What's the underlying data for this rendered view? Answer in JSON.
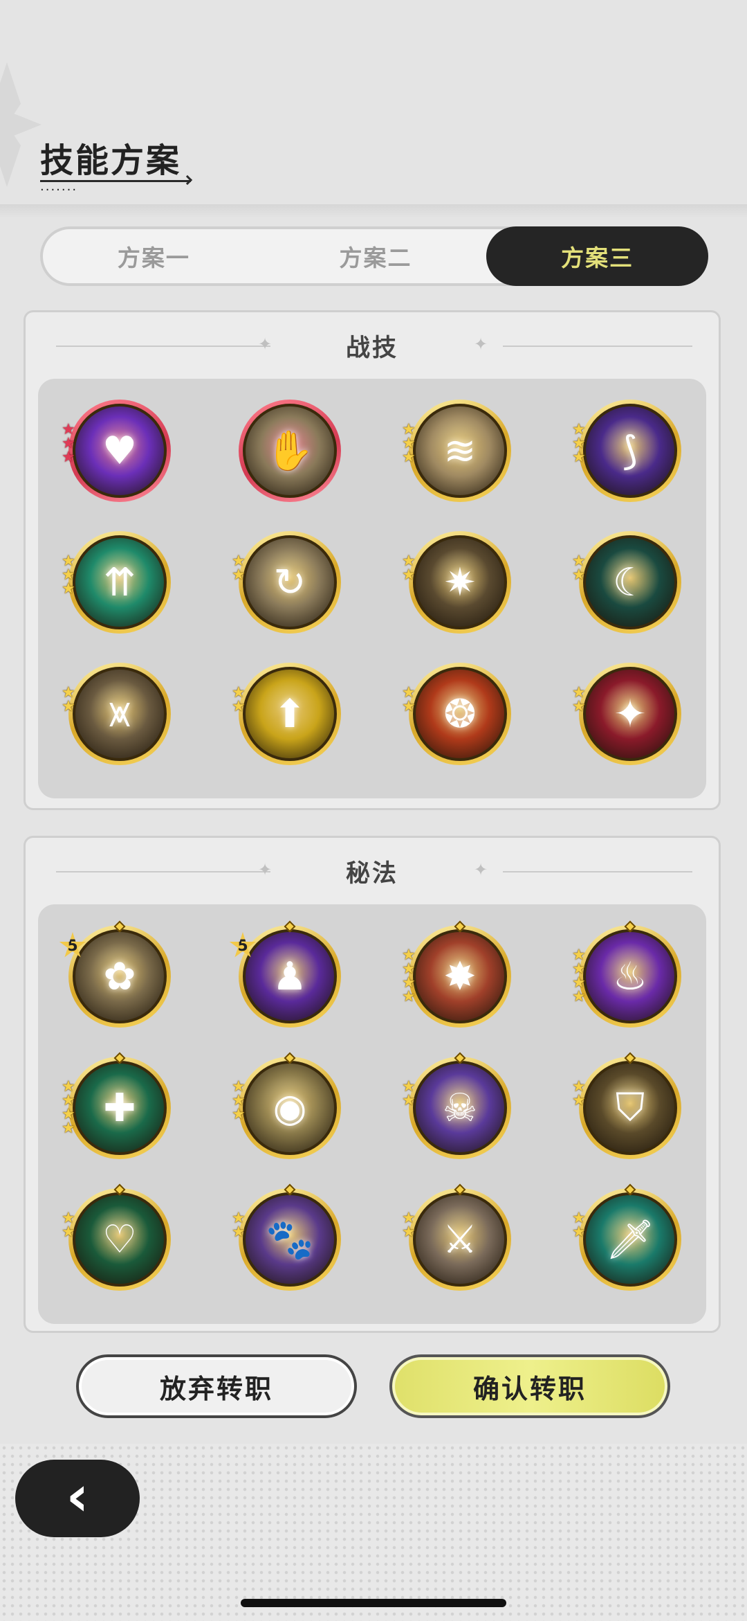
{
  "header": {
    "title": "技能方案"
  },
  "tabs": [
    {
      "label": "方案一",
      "active": false
    },
    {
      "label": "方案二",
      "active": false
    },
    {
      "label": "方案三",
      "active": true
    }
  ],
  "combat": {
    "title": "战技",
    "skills": [
      {
        "icon": "purple-heart-burst-icon",
        "stars": 3,
        "rarity": "red",
        "glyph": "♥",
        "bg": "#6b2fb8"
      },
      {
        "icon": "hand-grab-icon",
        "stars": 0,
        "rarity": "red",
        "glyph": "✋",
        "bg": "#8a7a5a"
      },
      {
        "icon": "wind-swirl-icon",
        "stars": 3,
        "rarity": "gold",
        "glyph": "≋",
        "bg": "#a08a62"
      },
      {
        "icon": "purple-claw-icon",
        "stars": 3,
        "rarity": "gold",
        "glyph": "⟆",
        "bg": "#4a2a8a"
      },
      {
        "icon": "green-arrows-up-icon",
        "stars": 3,
        "rarity": "gold",
        "glyph": "⇈",
        "bg": "#1f8a6a"
      },
      {
        "icon": "swirl-dash-icon",
        "stars": 2,
        "rarity": "gold",
        "glyph": "↻",
        "bg": "#8a7a5a"
      },
      {
        "icon": "light-explosion-icon",
        "stars": 2,
        "rarity": "gold",
        "glyph": "✷",
        "bg": "#5a4a30"
      },
      {
        "icon": "green-slash-icon",
        "stars": 2,
        "rarity": "gold",
        "glyph": "☾",
        "bg": "#1a4a40"
      },
      {
        "icon": "ground-spikes-icon",
        "stars": 2,
        "rarity": "gold",
        "glyph": "⩙",
        "bg": "#6a5a40"
      },
      {
        "icon": "golden-shield-boost-icon",
        "stars": 2,
        "rarity": "gold",
        "glyph": "⬆",
        "bg": "#c9a41a"
      },
      {
        "icon": "flame-guard-icon",
        "stars": 2,
        "rarity": "gold",
        "glyph": "❂",
        "bg": "#b03a1a"
      },
      {
        "icon": "rage-figure-icon",
        "stars": 2,
        "rarity": "gold",
        "glyph": "✦",
        "bg": "#8a1a2a"
      }
    ]
  },
  "secret": {
    "title": "秘法",
    "skills": [
      {
        "icon": "silver-leaf-icon",
        "level": "5",
        "glyph": "✿",
        "bg": "#7a6a4a"
      },
      {
        "icon": "purple-aura-figure-icon",
        "level": "5",
        "glyph": "♟",
        "bg": "#5a2a9a"
      },
      {
        "icon": "red-strike-icon",
        "stars": 4,
        "glyph": "✸",
        "bg": "#a0402a"
      },
      {
        "icon": "purple-fire-icon",
        "stars": 4,
        "glyph": "♨",
        "bg": "#6a2aa8"
      },
      {
        "icon": "green-heal-plus-icon",
        "stars": 4,
        "glyph": "✚",
        "bg": "#1a6a4a"
      },
      {
        "icon": "golden-eye-icon",
        "stars": 3,
        "glyph": "◉",
        "bg": "#8a7a4a"
      },
      {
        "icon": "purple-skull-icon",
        "stars": 2,
        "glyph": "☠",
        "bg": "#5a3a9a"
      },
      {
        "icon": "golden-armor-icon",
        "stars": 2,
        "glyph": "⛉",
        "bg": "#5a4a2a"
      },
      {
        "icon": "green-heart-plus-icon",
        "stars": 2,
        "glyph": "♡",
        "bg": "#1a5a3a"
      },
      {
        "icon": "purple-beast-icon",
        "stars": 2,
        "glyph": "🐾",
        "bg": "#5a3a8a"
      },
      {
        "icon": "sword-boost-icon",
        "stars": 2,
        "glyph": "⚔",
        "bg": "#7a6a5a"
      },
      {
        "icon": "green-sword-icon",
        "stars": 2,
        "glyph": "🗡",
        "bg": "#1a7a6a"
      }
    ]
  },
  "actions": {
    "abandon": "放弃转职",
    "confirm": "确认转职"
  },
  "colors": {
    "active_tab_bg": "#252525",
    "active_tab_text": "#e3e07a",
    "confirm_bg": "#e6e77a",
    "gold_ring": "#d9a92b",
    "red_ring": "#d43a52"
  }
}
